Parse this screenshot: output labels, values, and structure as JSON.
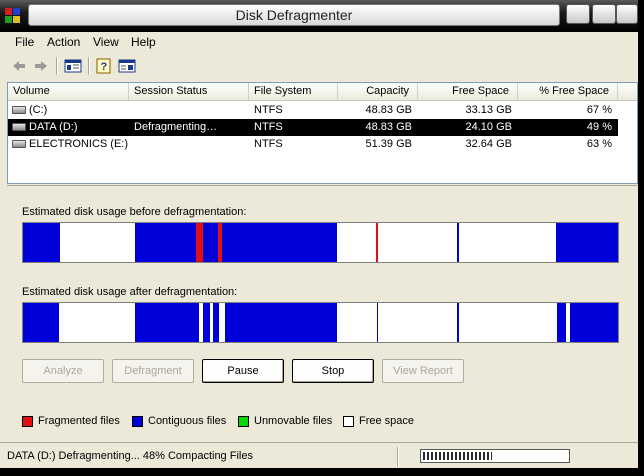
{
  "window": {
    "title": "Disk Defragmenter"
  },
  "menu": [
    "File",
    "Action",
    "View",
    "Help"
  ],
  "toolbar": {
    "icons": [
      "back-arrow-icon",
      "forward-arrow-icon",
      "show-hide-tree-icon",
      "help-icon",
      "properties-icon"
    ]
  },
  "volumes": {
    "columns": [
      "Volume",
      "Session Status",
      "File System",
      "Capacity",
      "Free Space",
      "% Free Space"
    ],
    "rows": [
      {
        "volume": "(C:)",
        "status": "",
        "fs": "NTFS",
        "capacity": "48.83 GB",
        "free": "33.13 GB",
        "pct": "67 %",
        "selected": false
      },
      {
        "volume": "DATA (D:)",
        "status": "Defragmenting…",
        "fs": "NTFS",
        "capacity": "48.83 GB",
        "free": "24.10 GB",
        "pct": "49 %",
        "selected": true
      },
      {
        "volume": "ELECTRONICS (E:)",
        "status": "",
        "fs": "NTFS",
        "capacity": "51.39 GB",
        "free": "32.64 GB",
        "pct": "63 %",
        "selected": false
      }
    ]
  },
  "display": {
    "before_label": "Estimated disk usage before defragmentation:",
    "after_label": "Estimated disk usage after defragmentation:",
    "before_segments": [
      {
        "from": 0,
        "to": 6.2,
        "type": "contiguous"
      },
      {
        "from": 18.8,
        "to": 29.0,
        "type": "contiguous"
      },
      {
        "from": 29.0,
        "to": 30.2,
        "type": "fragmented"
      },
      {
        "from": 30.2,
        "to": 32.7,
        "type": "contiguous"
      },
      {
        "from": 32.7,
        "to": 33.5,
        "type": "fragmented"
      },
      {
        "from": 33.5,
        "to": 52.8,
        "type": "contiguous"
      },
      {
        "from": 59.3,
        "to": 59.6,
        "type": "fragmented"
      },
      {
        "from": 73.0,
        "to": 73.2,
        "type": "contiguous"
      },
      {
        "from": 89.6,
        "to": 100,
        "type": "contiguous"
      }
    ],
    "after_segments": [
      {
        "from": 0,
        "to": 6.0,
        "type": "contiguous"
      },
      {
        "from": 18.8,
        "to": 29.6,
        "type": "contiguous"
      },
      {
        "from": 30.3,
        "to": 31.5,
        "type": "contiguous"
      },
      {
        "from": 31.9,
        "to": 33.0,
        "type": "contiguous"
      },
      {
        "from": 34.0,
        "to": 52.8,
        "type": "contiguous"
      },
      {
        "from": 59.5,
        "to": 59.7,
        "type": "contiguous"
      },
      {
        "from": 73.0,
        "to": 73.2,
        "type": "contiguous"
      },
      {
        "from": 89.7,
        "to": 91.2,
        "type": "contiguous"
      },
      {
        "from": 92.0,
        "to": 100,
        "type": "contiguous"
      }
    ],
    "colors": {
      "fragmented": "#e01010",
      "contiguous": "#0000d8",
      "unmovable": "#00d800",
      "free": "#ffffff"
    }
  },
  "buttons": {
    "analyze": "Analyze",
    "defragment": "Defragment",
    "pause": "Pause",
    "stop": "Stop",
    "view_report": "View Report"
  },
  "legend": {
    "fragmented": "Fragmented files",
    "contiguous": "Contiguous files",
    "unmovable": "Unmovable files",
    "free": "Free space"
  },
  "status": {
    "text": "DATA (D:) Defragmenting... 48%   Compacting Files",
    "progress_percent": 48
  }
}
